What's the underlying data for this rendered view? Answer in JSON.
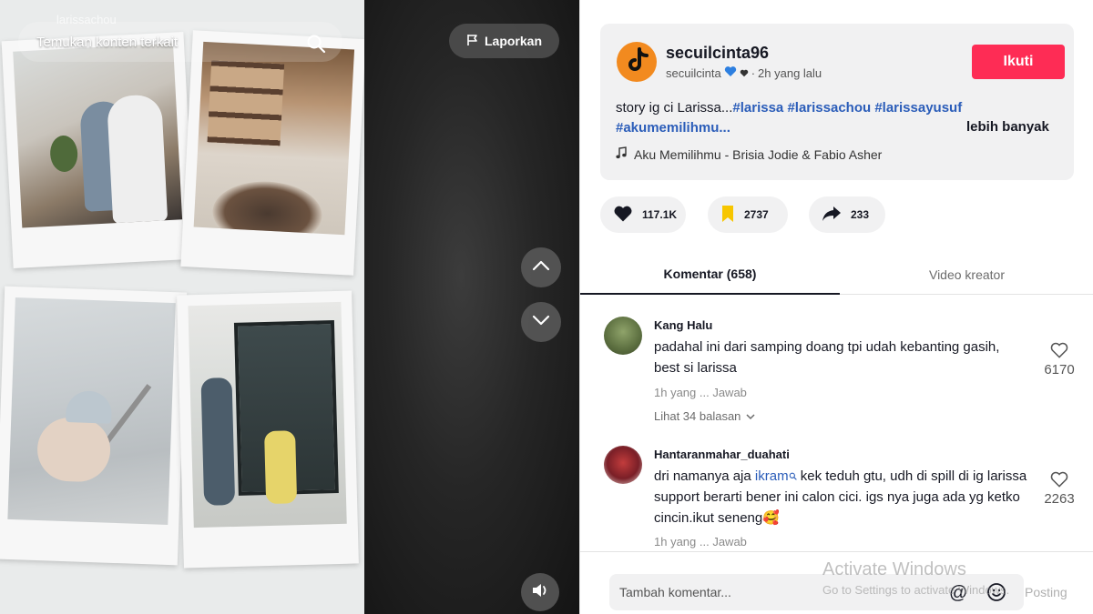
{
  "video": {
    "username_overlay": "larissachou",
    "search_text": "Temukan konten terkait",
    "report_label": "Laporkan",
    "icons": {
      "search": "search-icon",
      "report": "flag-icon",
      "up": "chevron-up-icon",
      "down": "chevron-down-icon",
      "volume": "volume-icon"
    }
  },
  "author": {
    "name": "secuilcinta96",
    "handle": "secuilcinta",
    "time_ago": "2h yang lalu",
    "avatar_color": "#f28a1f"
  },
  "follow_label": "Ikuti",
  "caption": {
    "text": "story ig ci Larissa...",
    "hashtags": [
      "#larissa",
      "#larissachou",
      "#larissayusuf",
      "#akumemilihmu..."
    ],
    "more_label": "lebih banyak"
  },
  "music": "Aku Memilihmu - Brisia Jodie & Fabio Asher",
  "stats": {
    "likes": "117.1K",
    "saves": "2737",
    "shares": "233"
  },
  "tabs": {
    "comments": "Komentar (658)",
    "creator_videos": "Video kreator"
  },
  "comments": [
    {
      "user": "Kang Halu",
      "text": "padahal ini dari samping doang tpi udah kebanting gasih, best si larissa",
      "meta": "1h yang ... Jawab",
      "likes": "6170",
      "replies": "Lihat 34 balasan"
    },
    {
      "user": "Hantaranmahar_duahati",
      "text_before": "dri namanya aja ",
      "mention": "ikram",
      "text_after": " kek teduh gtu, udh di spill di ig larissa support berarti bener ini calon cici. igs nya juga ada yg ketko cincin.ikut seneng🥰",
      "meta": "1h yang ... Jawab",
      "likes": "2263"
    }
  ],
  "composer": {
    "placeholder": "Tambah komentar...",
    "post_label": "Posting"
  },
  "watermark": {
    "title": "Activate Windows",
    "subtitle": "Go to Settings to activate Windows."
  },
  "colors": {
    "accent": "#fe2c55",
    "hashtag": "#2b5db9",
    "card_bg": "#f1f1f2"
  }
}
